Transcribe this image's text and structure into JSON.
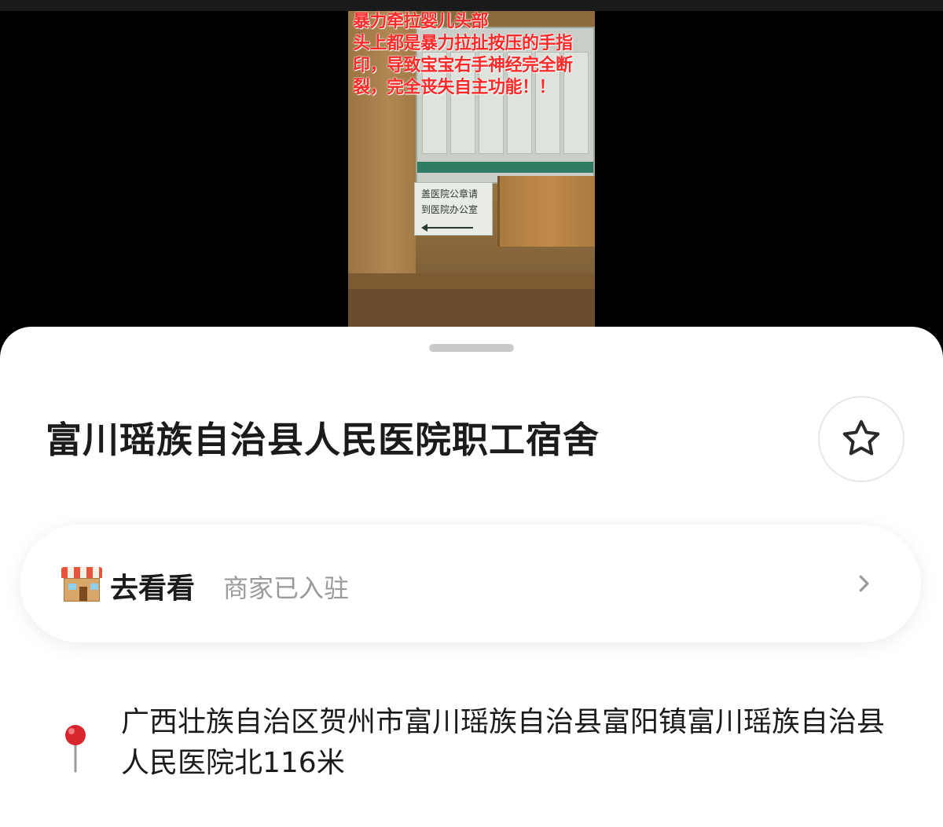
{
  "video": {
    "caption": "暴力牵拉婴儿头部\n头上都是暴力拉扯按压的手指印，导致宝宝右手神经完全断裂，完全丧失自主功能！！",
    "sign_text": "盖医院公章请到医院办公室"
  },
  "place": {
    "title": "富川瑶族自治县人民医院职工宿舍",
    "favorite_icon": "star-outline-icon"
  },
  "merchant": {
    "icon": "store-icon",
    "label": "去看看",
    "sub_label": "商家已入驻"
  },
  "address": {
    "icon": "map-pin-icon",
    "text": "广西壮族自治区贺州市富川瑶族自治县富阳镇富川瑶族自治县人民医院北116米"
  }
}
